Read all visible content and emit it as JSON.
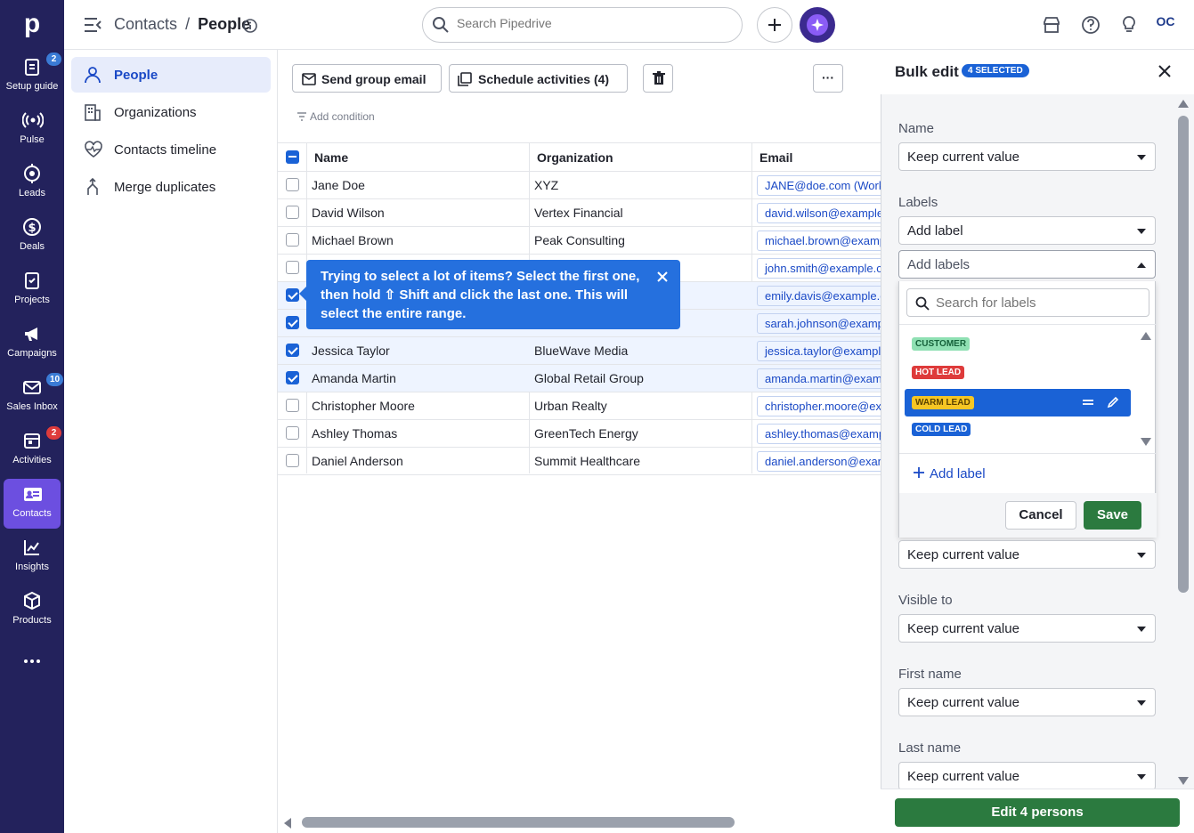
{
  "rail": {
    "logo": "p",
    "items": [
      {
        "label": "Setup guide",
        "badge": "2",
        "icon": "clipboard-icon"
      },
      {
        "label": "Pulse",
        "badge": "",
        "icon": "broadcast-icon"
      },
      {
        "label": "Leads",
        "badge": "",
        "icon": "target-icon"
      },
      {
        "label": "Deals",
        "badge": "",
        "icon": "dollar-icon"
      },
      {
        "label": "Projects",
        "badge": "",
        "icon": "projects-icon"
      },
      {
        "label": "Campaigns",
        "badge": "",
        "icon": "megaphone-icon"
      },
      {
        "label": "Sales Inbox",
        "badge": "10",
        "icon": "mail-icon"
      },
      {
        "label": "Activities",
        "badge": "2",
        "icon": "calendar-icon"
      },
      {
        "label": "Contacts",
        "badge": "",
        "icon": "contacts-icon"
      },
      {
        "label": "Insights",
        "badge": "",
        "icon": "chart-icon"
      },
      {
        "label": "Products",
        "badge": "",
        "icon": "box-icon"
      },
      {
        "label": "",
        "badge": "",
        "icon": "more-icon"
      }
    ]
  },
  "topbar": {
    "crumb_parent": "Contacts",
    "crumb_sep": "/",
    "crumb_current": "People",
    "search_placeholder": "Search Pipedrive",
    "account": "OC"
  },
  "subnav": [
    {
      "label": "People"
    },
    {
      "label": "Organizations"
    },
    {
      "label": "Contacts timeline"
    },
    {
      "label": "Merge duplicates"
    }
  ],
  "toolbar": {
    "send_email": "Send group email",
    "schedule": "Schedule activities (4)",
    "more": "···",
    "add_condition": "Add condition"
  },
  "table": {
    "headers": [
      "Name",
      "Organization",
      "Email"
    ],
    "rows": [
      {
        "name": "Jane Doe",
        "org": "XYZ",
        "email": "JANE@doe.com (Work)",
        "checked": false
      },
      {
        "name": "David Wilson",
        "org": "Vertex Financial",
        "email": "david.wilson@example.com",
        "checked": false
      },
      {
        "name": "Michael Brown",
        "org": "Peak Consulting",
        "email": "michael.brown@example.com",
        "checked": false
      },
      {
        "name": "",
        "org": "",
        "email": "john.smith@example.com",
        "checked": false
      },
      {
        "name": "",
        "org": "",
        "email": "emily.davis@example.com",
        "checked": true
      },
      {
        "name": "",
        "org": "",
        "email": "sarah.johnson@example.com",
        "checked": true
      },
      {
        "name": "Jessica Taylor",
        "org": "BlueWave Media",
        "email": "jessica.taylor@example.com",
        "checked": true
      },
      {
        "name": "Amanda Martin",
        "org": "Global Retail Group",
        "email": "amanda.martin@example.com",
        "checked": true
      },
      {
        "name": "Christopher Moore",
        "org": "Urban Realty",
        "email": "christopher.moore@example.com",
        "checked": false
      },
      {
        "name": "Ashley Thomas",
        "org": "GreenTech Energy",
        "email": "ashley.thomas@example.com",
        "checked": false
      },
      {
        "name": "Daniel Anderson",
        "org": "Summit Healthcare",
        "email": "daniel.anderson@example.com",
        "checked": false
      }
    ]
  },
  "tooltip": {
    "text": "Trying to select a lot of items? Select the first one, then hold ⇧ Shift and click the last one. This will select the entire range."
  },
  "bulk": {
    "title": "Bulk edit",
    "selected_badge": "4 SELECTED",
    "fields": [
      {
        "label": "Name",
        "value": "Keep current value"
      },
      {
        "label": "Labels",
        "value": "Add label"
      }
    ],
    "labels_select": "Add labels",
    "label_search_placeholder": "Search for labels",
    "label_options": [
      {
        "name": "CUSTOMER",
        "bg": "#8fe0b3",
        "fg": "#15613a"
      },
      {
        "name": "HOT LEAD",
        "bg": "#de3b3b",
        "fg": "#ffffff"
      },
      {
        "name": "WARM LEAD",
        "bg": "#f6c624",
        "fg": "#5c4300"
      },
      {
        "name": "COLD LEAD",
        "bg": "#1a62d6",
        "fg": "#ffffff"
      }
    ],
    "add_label": "Add label",
    "cancel": "Cancel",
    "save": "Save",
    "after_fields": [
      {
        "label": "",
        "value": "Keep current value"
      },
      {
        "label": "Visible to",
        "value": "Keep current value"
      },
      {
        "label": "First name",
        "value": "Keep current value"
      },
      {
        "label": "Last name",
        "value": "Keep current value"
      }
    ],
    "submit": "Edit 4 persons"
  },
  "colors": {
    "rail": "#23225c",
    "accent": "#6c4fe0",
    "primary_green": "#2b7a3f",
    "link": "#1a49c6"
  }
}
